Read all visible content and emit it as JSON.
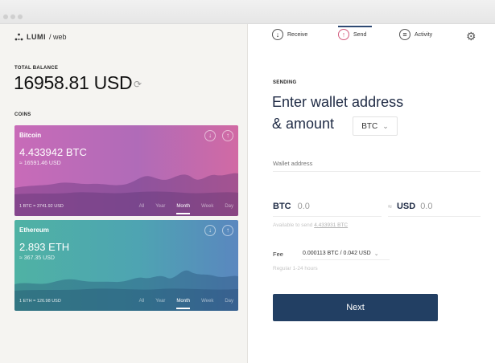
{
  "app": {
    "brand": "LUMI",
    "brand_suffix": "/ web"
  },
  "balance": {
    "label": "TOTAL BALANCE",
    "value": "16958.81 USD"
  },
  "coins": {
    "label": "COINS",
    "items": [
      {
        "name": "Bitcoin",
        "amount": "4.433942 BTC",
        "usd": "≈ 16591.46 USD",
        "rate": "1 BTC = 3741.92 USD",
        "periods": [
          "All",
          "Year",
          "Month",
          "Week",
          "Day"
        ],
        "active_period": "Month",
        "color": "#c86bb8"
      },
      {
        "name": "Ethereum",
        "amount": "2.893 ETH",
        "usd": "≈ 367.35 USD",
        "rate": "1 ETH = 126.98 USD",
        "periods": [
          "All",
          "Year",
          "Month",
          "Week",
          "Day"
        ],
        "active_period": "Month",
        "color": "#4fb2a4"
      }
    ]
  },
  "tabs": [
    {
      "label": "Receive",
      "icon": "arrow-down-icon"
    },
    {
      "label": "Send",
      "icon": "arrow-up-icon",
      "active": true
    },
    {
      "label": "Activity",
      "icon": "list-icon"
    }
  ],
  "send": {
    "section_label": "SENDING",
    "heading_line1": "Enter wallet address",
    "heading_line2": "& amount",
    "currency": "BTC",
    "wallet_placeholder": "Wallet address",
    "amount_currency": "BTC",
    "amount_value": "0.0",
    "approx": "≈",
    "fiat_currency": "USD",
    "fiat_value": "0.0",
    "available_prefix": "Available to send",
    "available_amount": "4.433931 BTC",
    "fee_label": "Fee",
    "fee_value": "0.000113 BTC / 0.042 USD",
    "fee_note": "Regular 1-24 hours",
    "next_label": "Next"
  },
  "colors": {
    "accent": "#223f63",
    "send_accent": "#d25a7c"
  }
}
